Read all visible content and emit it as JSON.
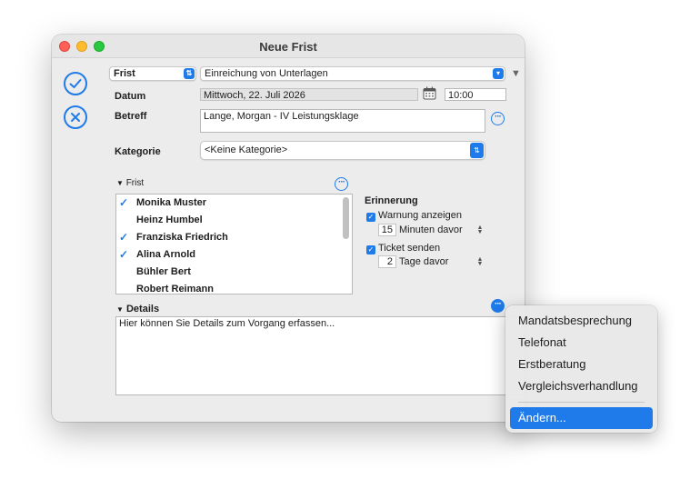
{
  "window": {
    "title": "Neue Frist"
  },
  "header": {
    "type_select": "Frist",
    "subject_select": "Einreichung von Unterlagen"
  },
  "form": {
    "datum_label": "Datum",
    "datum_value": "Mittwoch, 22. Juli 2026",
    "time_value": "10:00",
    "betreff_label": "Betreff",
    "betreff_value": "Lange, Morgan - IV Leistungsklage",
    "kategorie_label": "Kategorie",
    "kategorie_value": "<Keine Kategorie>"
  },
  "frist_section": {
    "label": "Frist",
    "people": [
      {
        "name": "Monika Muster",
        "checked": true
      },
      {
        "name": "Heinz Humbel",
        "checked": false
      },
      {
        "name": "Franziska Friedrich",
        "checked": true
      },
      {
        "name": "Alina Arnold",
        "checked": true
      },
      {
        "name": "Bühler Bert",
        "checked": false
      },
      {
        "name": "Robert Reimann",
        "checked": false
      }
    ]
  },
  "erinnerung": {
    "title": "Erinnerung",
    "warnung_label": "Warnung anzeigen",
    "warnung_value": "15",
    "warnung_unit": "Minuten davor",
    "ticket_label": "Ticket senden",
    "ticket_value": "2",
    "ticket_unit": "Tage davor"
  },
  "details": {
    "label": "Details",
    "placeholder": "Hier können Sie Details zum Vorgang erfassen..."
  },
  "menu": {
    "items": [
      "Mandatsbesprechung",
      "Telefonat",
      "Erstberatung",
      "Vergleichsverhandlung"
    ],
    "action": "Ändern..."
  },
  "colors": {
    "accent": "#1f7bea"
  }
}
